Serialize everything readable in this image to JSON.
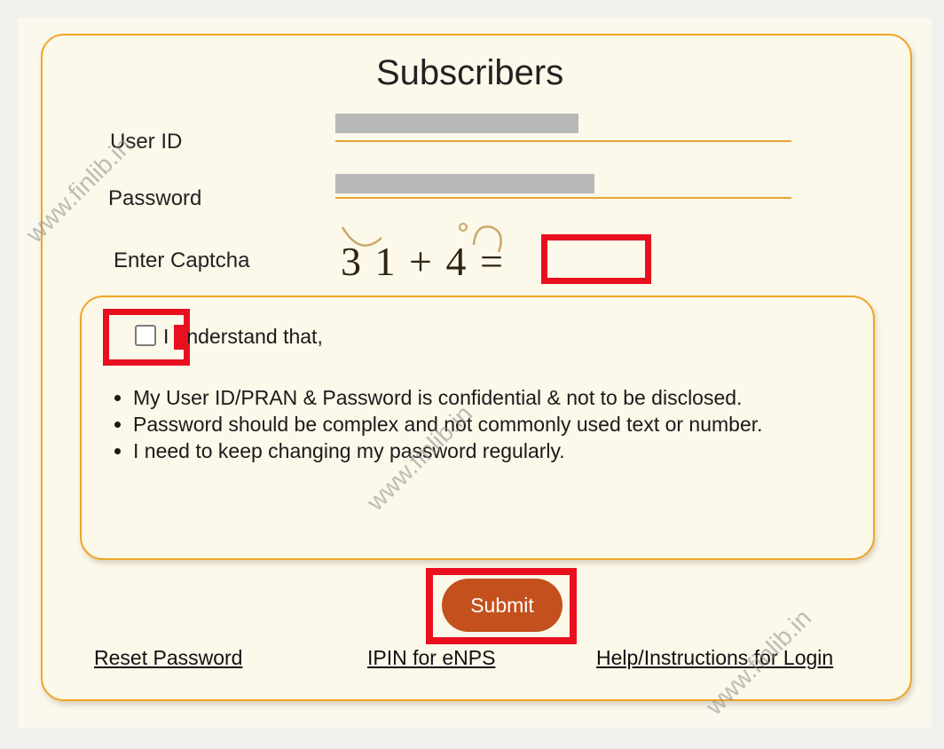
{
  "title": "Subscribers",
  "fields": {
    "user_id_label": "User ID",
    "password_label": "Password",
    "captcha_label": "Enter Captcha",
    "captcha_text": "3 1 + 4 ="
  },
  "terms": {
    "checkbox_label_start": "I",
    "checkbox_label_rest": "nderstand that,",
    "bullets": [
      "My User ID/PRAN & Password is confidential & not to be disclosed.",
      "Password should be complex and not commonly used text or number.",
      "I need to keep changing my password regularly."
    ]
  },
  "submit_label": "Submit",
  "links": {
    "reset_password": "Reset Password",
    "ipin": "IPIN for eNPS",
    "help": "Help/Instructions for Login"
  },
  "watermark": "www.finlib.in",
  "colors": {
    "accent_border": "#f0a526",
    "submit_bg": "#c4501d",
    "highlight": "#e8101f",
    "card_bg": "#fcf8ea"
  }
}
